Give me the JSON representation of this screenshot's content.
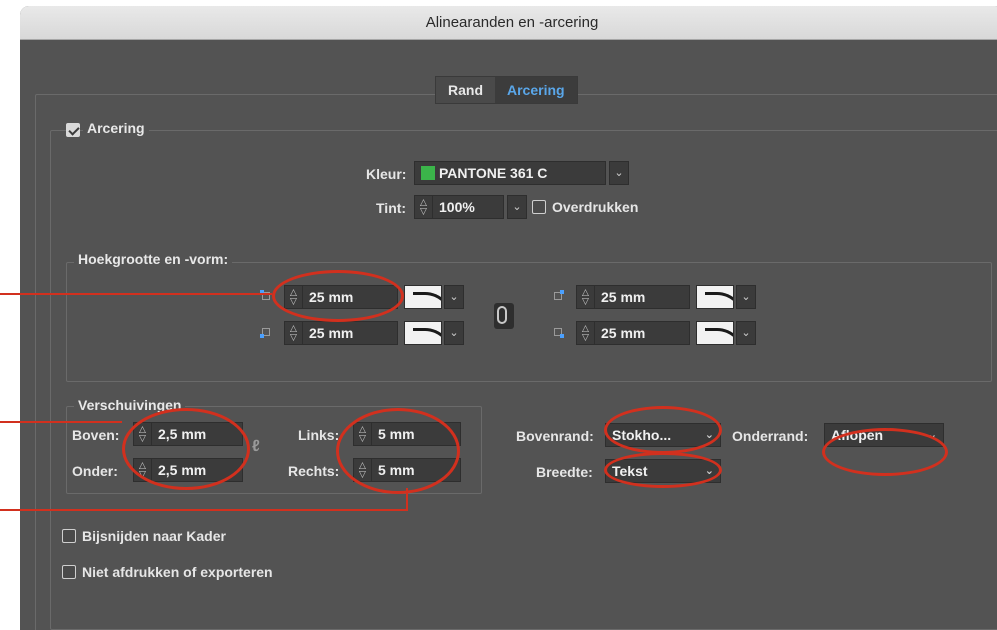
{
  "window": {
    "title": "Alinearanden en -arcering"
  },
  "tabs": [
    {
      "label": "Rand",
      "active": false
    },
    {
      "label": "Arcering",
      "active": true
    }
  ],
  "shading": {
    "enabled_label": "Arcering",
    "enabled": true,
    "color_label": "Kleur:",
    "color_value": "PANTONE 361 C",
    "color_swatch": "#3bb54a",
    "tint_label": "Tint:",
    "tint_value": "100%",
    "overprint_label": "Overdrukken",
    "overprint": false
  },
  "corners": {
    "legend": "Hoekgrootte en -vorm:",
    "top_left": "25 mm",
    "bottom_left": "25 mm",
    "top_right": "25 mm",
    "bottom_right": "25 mm"
  },
  "offsets": {
    "legend": "Verschuivingen",
    "top_label": "Boven:",
    "top_value": "2,5 mm",
    "bottom_label": "Onder:",
    "bottom_value": "2,5 mm",
    "left_label": "Links:",
    "left_value": "5 mm",
    "right_label": "Rechts:",
    "right_value": "5 mm"
  },
  "edges": {
    "top_label": "Bovenrand:",
    "top_value": "Stokho...",
    "bottom_label": "Onderrand:",
    "bottom_value": "Aflopen",
    "width_label": "Breedte:",
    "width_value": "Tekst"
  },
  "options": {
    "clip_label": "Bijsnijden naar Kader",
    "clip": false,
    "noprint_label": "Niet afdrukken of exporteren",
    "noprint": false
  },
  "colors": {
    "annotation": "#d2301e",
    "accent": "#5aa7ea"
  }
}
